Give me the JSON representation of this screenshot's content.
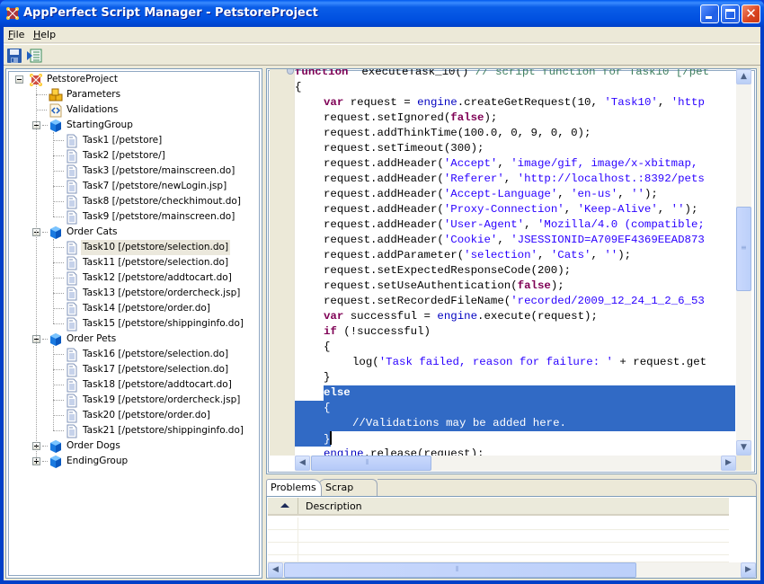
{
  "window": {
    "title": "AppPerfect Script Manager - PetstoreProject",
    "controls": {
      "minimize": "minimize",
      "maximize": "maximize",
      "close": "close"
    }
  },
  "menu": [
    {
      "label_ul": "F",
      "label_rest": "ile"
    },
    {
      "label_ul": "H",
      "label_rest": "elp"
    }
  ],
  "toolbar": {
    "save": "save-icon",
    "run": "run-script-icon"
  },
  "tree": {
    "root": {
      "label": "PetstoreProject",
      "icon": "project-icon",
      "expanded": true
    },
    "items": [
      {
        "label": "Parameters",
        "icon": "parameters-icon"
      },
      {
        "label": "Validations",
        "icon": "validations-icon"
      }
    ],
    "groups": [
      {
        "label": "StartingGroup",
        "expanded": true,
        "tasks": [
          "Task1 [/petstore]",
          "Task2 [/petstore/]",
          "Task3 [/petstore/mainscreen.do]",
          "Task7 [/petstore/newLogin.jsp]",
          "Task8 [/petstore/checkhimout.do]",
          "Task9 [/petstore/mainscreen.do]"
        ]
      },
      {
        "label": "Order Cats",
        "expanded": true,
        "tasks": [
          "Task10 [/petstore/selection.do]",
          "Task11 [/petstore/selection.do]",
          "Task12 [/petstore/addtocart.do]",
          "Task13 [/petstore/ordercheck.jsp]",
          "Task14 [/petstore/order.do]",
          "Task15 [/petstore/shippinginfo.do]"
        ]
      },
      {
        "label": "Order Pets",
        "expanded": true,
        "tasks": [
          "Task16 [/petstore/selection.do]",
          "Task17 [/petstore/selection.do]",
          "Task18 [/petstore/addtocart.do]",
          "Task19 [/petstore/ordercheck.jsp]",
          "Task20 [/petstore/order.do]",
          "Task21 [/petstore/shippinginfo.do]"
        ]
      },
      {
        "label": "Order Dogs",
        "expanded": false,
        "tasks": []
      },
      {
        "label": "EndingGroup",
        "expanded": false,
        "tasks": []
      }
    ],
    "selected": "Task10 [/petstore/selection.do]"
  },
  "editor": {
    "lines": [
      {
        "indent": 0,
        "tokens": [
          [
            "kw",
            "function"
          ],
          [
            "",
            "  executeTask_10() "
          ],
          [
            "cm",
            "// script function for Task10 [/pet"
          ]
        ]
      },
      {
        "indent": 0,
        "tokens": [
          [
            "",
            "{"
          ]
        ]
      },
      {
        "indent": 1,
        "tokens": [
          [
            "kw",
            "var"
          ],
          [
            "",
            " request = "
          ],
          [
            "obj",
            "engine"
          ],
          [
            "",
            ".createGetRequest(10, "
          ],
          [
            "str",
            "'Task10'"
          ],
          [
            "",
            ", "
          ],
          [
            "str",
            "'http"
          ]
        ]
      },
      {
        "indent": 1,
        "tokens": [
          [
            "",
            "request.setIgnored("
          ],
          [
            "kw",
            "false"
          ],
          [
            "",
            ");"
          ]
        ]
      },
      {
        "indent": 1,
        "tokens": [
          [
            "",
            "request.addThinkTime(100.0, 0, 9, 0, 0);"
          ]
        ]
      },
      {
        "indent": 1,
        "tokens": [
          [
            "",
            "request.setTimeout(300);"
          ]
        ]
      },
      {
        "indent": 1,
        "tokens": [
          [
            "",
            "request.addHeader("
          ],
          [
            "str",
            "'Accept'"
          ],
          [
            "",
            ", "
          ],
          [
            "str",
            "'image/gif, image/x-xbitmap,"
          ]
        ]
      },
      {
        "indent": 1,
        "tokens": [
          [
            "",
            "request.addHeader("
          ],
          [
            "str",
            "'Referer'"
          ],
          [
            "",
            ", "
          ],
          [
            "str",
            "'http://localhost.:8392/pets"
          ]
        ]
      },
      {
        "indent": 1,
        "tokens": [
          [
            "",
            "request.addHeader("
          ],
          [
            "str",
            "'Accept-Language'"
          ],
          [
            "",
            ", "
          ],
          [
            "str",
            "'en-us'"
          ],
          [
            "",
            ", "
          ],
          [
            "str",
            "''"
          ],
          [
            "",
            ");"
          ]
        ]
      },
      {
        "indent": 1,
        "tokens": [
          [
            "",
            "request.addHeader("
          ],
          [
            "str",
            "'Proxy-Connection'"
          ],
          [
            "",
            ", "
          ],
          [
            "str",
            "'Keep-Alive'"
          ],
          [
            "",
            ", "
          ],
          [
            "str",
            "''"
          ],
          [
            "",
            ");"
          ]
        ]
      },
      {
        "indent": 1,
        "tokens": [
          [
            "",
            "request.addHeader("
          ],
          [
            "str",
            "'User-Agent'"
          ],
          [
            "",
            ", "
          ],
          [
            "str",
            "'Mozilla/4.0 (compatible;"
          ]
        ]
      },
      {
        "indent": 1,
        "tokens": [
          [
            "",
            "request.addHeader("
          ],
          [
            "str",
            "'Cookie'"
          ],
          [
            "",
            ", "
          ],
          [
            "str",
            "'JSESSIONID=A709EF4369EEAD873"
          ]
        ]
      },
      {
        "indent": 1,
        "tokens": [
          [
            "",
            "request.addParameter("
          ],
          [
            "str",
            "'selection'"
          ],
          [
            "",
            ", "
          ],
          [
            "str",
            "'Cats'"
          ],
          [
            "",
            ", "
          ],
          [
            "str",
            "''"
          ],
          [
            "",
            ");"
          ]
        ]
      },
      {
        "indent": 1,
        "tokens": [
          [
            "",
            "request.setExpectedResponseCode(200);"
          ]
        ]
      },
      {
        "indent": 1,
        "tokens": [
          [
            "",
            "request.setUseAuthentication("
          ],
          [
            "kw",
            "false"
          ],
          [
            "",
            ");"
          ]
        ]
      },
      {
        "indent": 1,
        "tokens": [
          [
            "",
            "request.setRecordedFileName("
          ],
          [
            "str",
            "'recorded/2009_12_24_1_2_6_53"
          ]
        ]
      },
      {
        "indent": 1,
        "tokens": [
          [
            "kw",
            "var"
          ],
          [
            "",
            " successful = "
          ],
          [
            "obj",
            "engine"
          ],
          [
            "",
            ".execute(request);"
          ]
        ]
      },
      {
        "indent": 1,
        "tokens": [
          [
            "kw",
            "if"
          ],
          [
            "",
            " (!successful)"
          ]
        ]
      },
      {
        "indent": 1,
        "tokens": [
          [
            "",
            "{"
          ]
        ]
      },
      {
        "indent": 2,
        "tokens": [
          [
            "",
            "log("
          ],
          [
            "str",
            "'Task failed, reason for failure: '"
          ],
          [
            "",
            " + request.get"
          ]
        ]
      },
      {
        "indent": 1,
        "tokens": [
          [
            "",
            "}"
          ]
        ]
      },
      {
        "indent": 1,
        "selected": "partial",
        "tokens": [
          [
            "kw",
            "else"
          ]
        ]
      },
      {
        "indent": 1,
        "selected": "full",
        "tokens": [
          [
            "",
            "{"
          ]
        ]
      },
      {
        "indent": 2,
        "selected": "full",
        "tokens": [
          [
            "cm",
            "//Validations may be added here."
          ]
        ]
      },
      {
        "indent": 1,
        "selected": "caret",
        "tokens": [
          [
            "",
            "}"
          ]
        ]
      },
      {
        "indent": 1,
        "tokens": [
          [
            "obj",
            "engine"
          ],
          [
            "",
            ".release(request);"
          ]
        ]
      }
    ],
    "vertical_scroll_fraction": 0.45
  },
  "bottom_panel": {
    "tabs": [
      {
        "label": "Problems",
        "active": true
      },
      {
        "label": "Scrap book",
        "active": false
      }
    ],
    "columns": [
      "",
      "Description"
    ],
    "rows": []
  }
}
